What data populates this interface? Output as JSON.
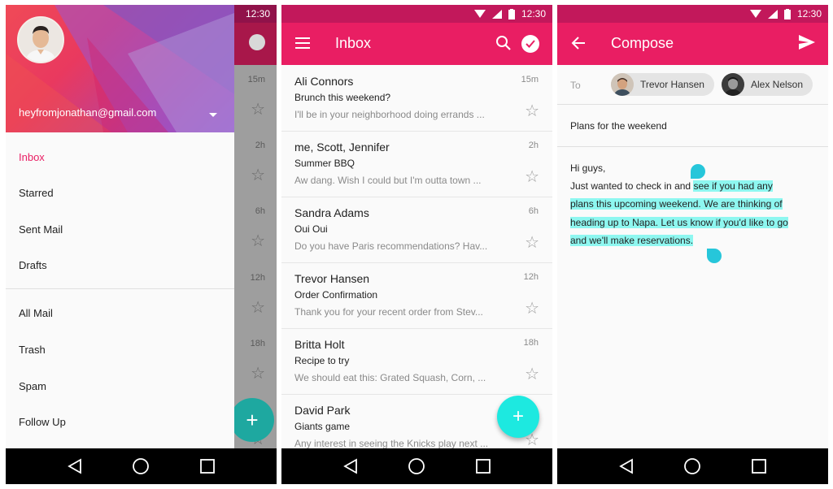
{
  "status": {
    "time": "12:30"
  },
  "drawer": {
    "email": "heyfromjonathan@gmail.com",
    "items": [
      {
        "label": "Inbox",
        "active": true
      },
      {
        "label": "Starred"
      },
      {
        "label": "Sent Mail"
      },
      {
        "label": "Drafts"
      },
      {
        "label": "All Mail"
      },
      {
        "label": "Trash"
      },
      {
        "label": "Spam"
      },
      {
        "label": "Follow Up"
      }
    ],
    "background_times": [
      "15m",
      "2h",
      "6h",
      "12h",
      "18h"
    ]
  },
  "inbox": {
    "title": "Inbox",
    "emails": [
      {
        "sender": "Ali Connors",
        "subject": "Brunch this weekend?",
        "snippet": "I'll be in your neighborhood doing errands ...",
        "time": "15m"
      },
      {
        "sender": "me, Scott, Jennifer",
        "subject": "Summer BBQ",
        "snippet": "Aw dang. Wish I could but I'm outta town ...",
        "time": "2h"
      },
      {
        "sender": "Sandra Adams",
        "subject": "Oui Oui",
        "snippet": "Do you have Paris recommendations? Hav...",
        "time": "6h"
      },
      {
        "sender": "Trevor Hansen",
        "subject": "Order Confirmation",
        "snippet": "Thank you for your recent order from Stev...",
        "time": "12h"
      },
      {
        "sender": "Britta Holt",
        "subject": "Recipe to try",
        "snippet": "We should eat this: Grated Squash, Corn, ...",
        "time": "18h"
      },
      {
        "sender": "David Park",
        "subject": "Giants game",
        "snippet": "Any interest in seeing the Knicks play next ...",
        "time": ""
      }
    ],
    "fab": "+"
  },
  "compose": {
    "title": "Compose",
    "to_label": "To",
    "recipients": [
      "Trevor Hansen",
      "Alex Nelson"
    ],
    "subject": "Plans for the weekend",
    "body": {
      "line1": "Hi guys,",
      "line2_plain": "Just wanted to check in and ",
      "line2_hl": "see if you had any",
      "line3": "plans this upcoming weekend. We are thinking of",
      "line4": "heading up to Napa. Let us know if you'd like to go",
      "line5": "and we'll make reservations."
    }
  },
  "colors": {
    "primary": "#e91e63",
    "status": "#c2185b",
    "accent": "#1de9e0",
    "highlight": "#8ef7f0"
  }
}
